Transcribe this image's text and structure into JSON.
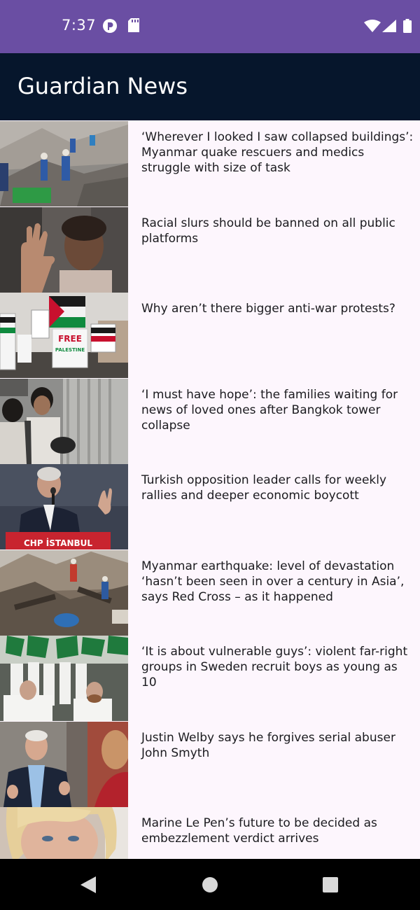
{
  "status_bar": {
    "time": "7:37",
    "icons": [
      "app-notification-icon",
      "sd-card-icon",
      "wifi-icon",
      "cell-signal-icon",
      "battery-icon"
    ]
  },
  "app_bar": {
    "title": "Guardian News"
  },
  "articles": [
    {
      "headline": "‘Wherever I looked I saw collapsed buildings’: Myanmar quake rescuers and medics struggle with size of task",
      "image": "rescuers-in-rubble"
    },
    {
      "headline": "Racial slurs should be banned on all public platforms",
      "image": "raised-hand-portrait"
    },
    {
      "headline": "Why aren’t there bigger anti-war protests?",
      "image": "protest-placards"
    },
    {
      "headline": "‘I must have hope’: the families waiting for news of loved ones after Bangkok tower collapse",
      "image": "waiting-families"
    },
    {
      "headline": "Turkish opposition leader calls for weekly rallies and deeper economic boycott",
      "image": "speaker-at-podium"
    },
    {
      "headline": "Myanmar earthquake: level of devastation ‘hasn’t been seen in over a century in Asia’, says Red Cross – as it happened",
      "image": "earthquake-debris"
    },
    {
      "headline": "‘It is about vulnerable guys’: violent far-right groups in Sweden recruit boys as young as 10",
      "image": "marching-group-with-flags"
    },
    {
      "headline": "Justin Welby says he forgives serial abuser John Smyth",
      "image": "man-speaking"
    },
    {
      "headline": "Marine Le Pen’s future to be decided as embezzlement verdict arrives",
      "image": "woman-portrait"
    }
  ],
  "thumb_texts": {
    "placard_free": "FREE",
    "placard_palestine": "PALESTINE",
    "podium_sign": "CHP İSTANBUL"
  },
  "colors": {
    "status_bar": "#6a4ea3",
    "app_bar": "#06162c",
    "list_background": "#fdf6fd",
    "headline_text": "#1b1b1f",
    "nav_bar": "#000000"
  },
  "nav_bar": {
    "buttons": [
      "back",
      "home",
      "recents"
    ]
  }
}
